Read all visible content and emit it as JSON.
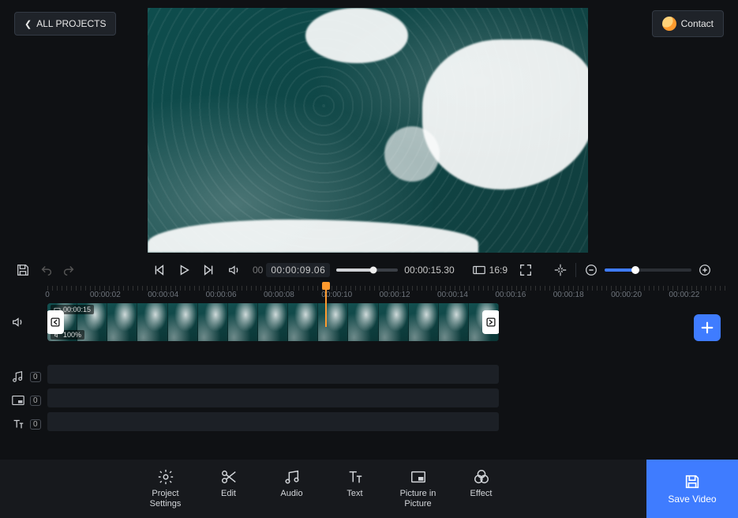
{
  "header": {
    "back_label": "ALL PROJECTS",
    "contact_label": "Contact"
  },
  "transport": {
    "current_time_prefix": "00",
    "current_time": "00:00:09.06",
    "total_time": "00:00:15.30",
    "aspect_label": "16:9"
  },
  "ruler": {
    "labels": [
      "0",
      "00:00:02",
      "00:00:04",
      "00:00:06",
      "00:00:08",
      "00:00:10",
      "00:00:12",
      "00:00:14",
      "00:00:16",
      "00:00:18",
      "00:00:20",
      "00:00:22"
    ]
  },
  "clip": {
    "duration_badge": "00:00:15",
    "volume_badge": "100%"
  },
  "tracks": {
    "audio_count": "0",
    "pip_count": "0",
    "text_count": "0"
  },
  "toolbar": {
    "project_settings": "Project\nSettings",
    "edit": "Edit",
    "audio": "Audio",
    "text": "Text",
    "pip": "Picture in\nPicture",
    "effect": "Effect",
    "save": "Save Video"
  }
}
